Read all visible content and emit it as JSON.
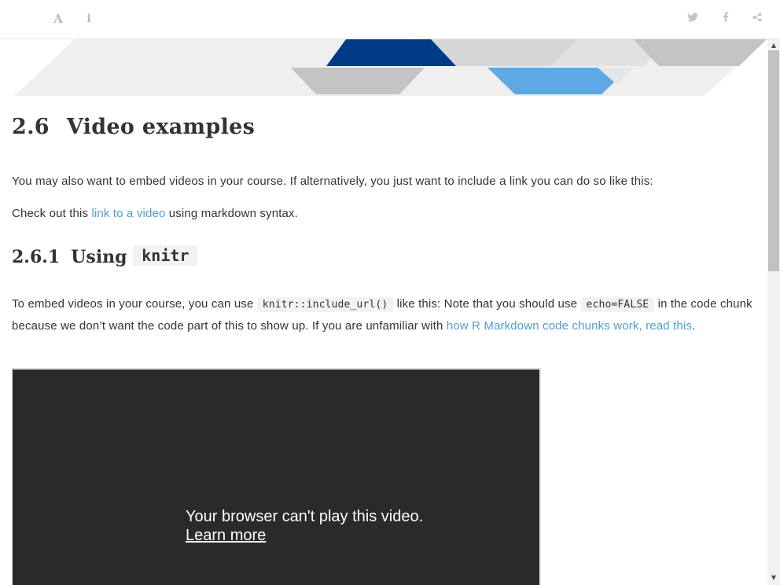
{
  "toolbar": {
    "font_icon": "A",
    "info_icon": "i",
    "icons": [
      "font-settings-icon",
      "info-icon",
      "twitter-icon",
      "facebook-icon",
      "share-icon"
    ]
  },
  "banner": {
    "colors": {
      "navy": "#003a86",
      "blue": "#5ea9e4",
      "gray": "#c4c4c4",
      "light": "#e9e9e9"
    }
  },
  "section": {
    "number": "2.6",
    "title": "Video examples",
    "intro": "You may also want to embed videos in your course. If alternatively, you just want to include a link you can do so like this:",
    "check_pre": "Check out this ",
    "check_link": "link to a video",
    "check_post": " using markdown syntax."
  },
  "subsection": {
    "number": "2.6.1",
    "title_word": "Using",
    "title_code": "knitr",
    "p_part1": "To embed videos in your course, you can use ",
    "code1": "knitr::include_url()",
    "p_part2": " like this: Note that you should use ",
    "code2": "echo=FALSE",
    "p_part3": " in the code chunk because we don’t want the code part of this to show up. If you are unfamiliar with ",
    "link": "how R Markdown code chunks work, read this",
    "p_end": "."
  },
  "video": {
    "message": "Your browser can't play this video.",
    "learn_more": "Learn more"
  },
  "scrollbar": {
    "position_fraction": 0.0
  },
  "colors": {
    "link": "#4e9cd1",
    "text": "#333333",
    "video_bg": "#2a2a2a"
  }
}
